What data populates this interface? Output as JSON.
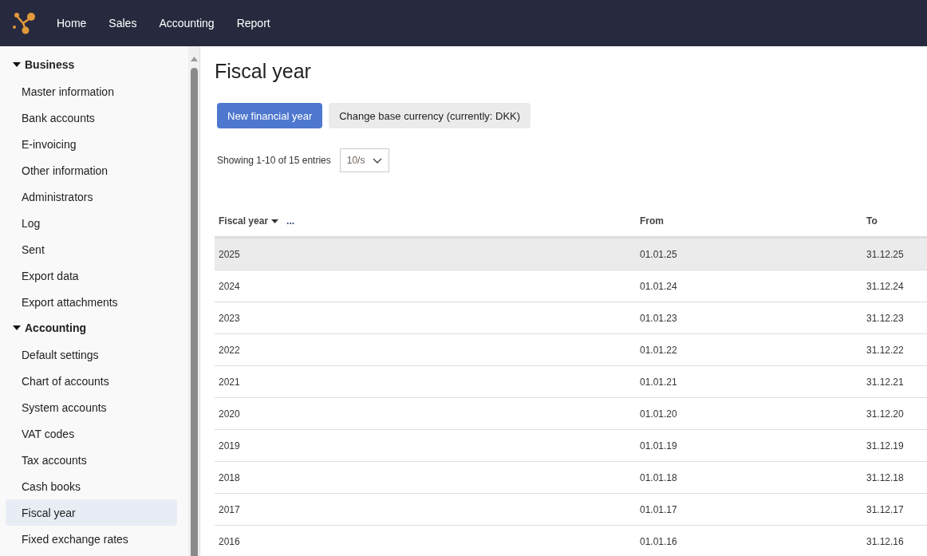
{
  "nav": [
    {
      "label": "Home"
    },
    {
      "label": "Sales"
    },
    {
      "label": "Accounting"
    },
    {
      "label": "Report"
    }
  ],
  "sidebar": {
    "groups": [
      {
        "label": "Business",
        "expanded": true,
        "items": [
          {
            "label": "Master information",
            "selected": false
          },
          {
            "label": "Bank accounts",
            "selected": false
          },
          {
            "label": "E-invoicing",
            "selected": false
          },
          {
            "label": "Other information",
            "selected": false
          },
          {
            "label": "Administrators",
            "selected": false
          },
          {
            "label": "Log",
            "selected": false
          },
          {
            "label": "Sent",
            "selected": false
          },
          {
            "label": "Export data",
            "selected": false
          },
          {
            "label": "Export attachments",
            "selected": false
          }
        ]
      },
      {
        "label": "Accounting",
        "expanded": true,
        "items": [
          {
            "label": "Default settings",
            "selected": false
          },
          {
            "label": "Chart of accounts",
            "selected": false
          },
          {
            "label": "System accounts",
            "selected": false
          },
          {
            "label": "VAT codes",
            "selected": false
          },
          {
            "label": "Tax accounts",
            "selected": false
          },
          {
            "label": "Cash books",
            "selected": false
          },
          {
            "label": "Fiscal year",
            "selected": true
          },
          {
            "label": "Fixed exchange rates",
            "selected": false
          }
        ]
      }
    ]
  },
  "page_title": "Fiscal year",
  "buttons": [
    {
      "label": "New financial year",
      "kind": "primary"
    },
    {
      "label": "Change base currency (currently: DKK)",
      "kind": "secondary"
    }
  ],
  "pagination": {
    "summary": "Showing 1-10 of 15 entries",
    "page_size": "10/s"
  },
  "table": {
    "columns": [
      {
        "label": "Fiscal year",
        "sorted": true,
        "menu": "..."
      },
      {
        "label": "From",
        "sorted": false
      },
      {
        "label": "To",
        "sorted": false
      }
    ],
    "rows": [
      {
        "cells": [
          "2025",
          "01.01.25",
          "31.12.25"
        ],
        "selected": true
      },
      {
        "cells": [
          "2024",
          "01.01.24",
          "31.12.24"
        ],
        "selected": false
      },
      {
        "cells": [
          "2023",
          "01.01.23",
          "31.12.23"
        ],
        "selected": false
      },
      {
        "cells": [
          "2022",
          "01.01.22",
          "31.12.22"
        ],
        "selected": false
      },
      {
        "cells": [
          "2021",
          "01.01.21",
          "31.12.21"
        ],
        "selected": false
      },
      {
        "cells": [
          "2020",
          "01.01.20",
          "31.12.20"
        ],
        "selected": false
      },
      {
        "cells": [
          "2019",
          "01.01.19",
          "31.12.19"
        ],
        "selected": false
      },
      {
        "cells": [
          "2018",
          "01.01.18",
          "31.12.18"
        ],
        "selected": false
      },
      {
        "cells": [
          "2017",
          "01.01.17",
          "31.12.17"
        ],
        "selected": false
      },
      {
        "cells": [
          "2016",
          "01.01.16",
          "31.12.16"
        ],
        "selected": false
      }
    ]
  }
}
